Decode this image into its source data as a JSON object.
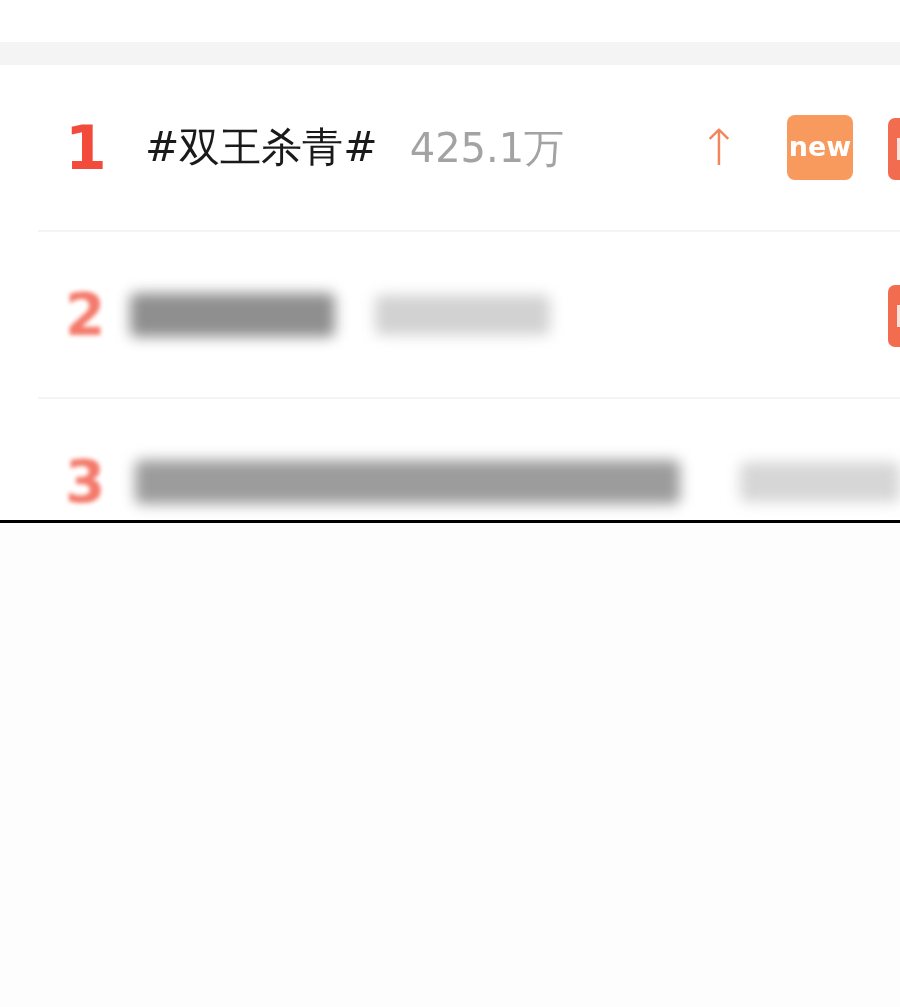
{
  "hot_list": [
    {
      "kind": "clear",
      "rank": "1",
      "title": "#双王杀青#",
      "count": "425.1万",
      "trend": "↑",
      "badge": "new",
      "edge_badge": true
    },
    {
      "kind": "blurred",
      "rank": "2",
      "edge_badge": true
    },
    {
      "kind": "truncated",
      "rank": "3",
      "edge_badge": false
    }
  ]
}
